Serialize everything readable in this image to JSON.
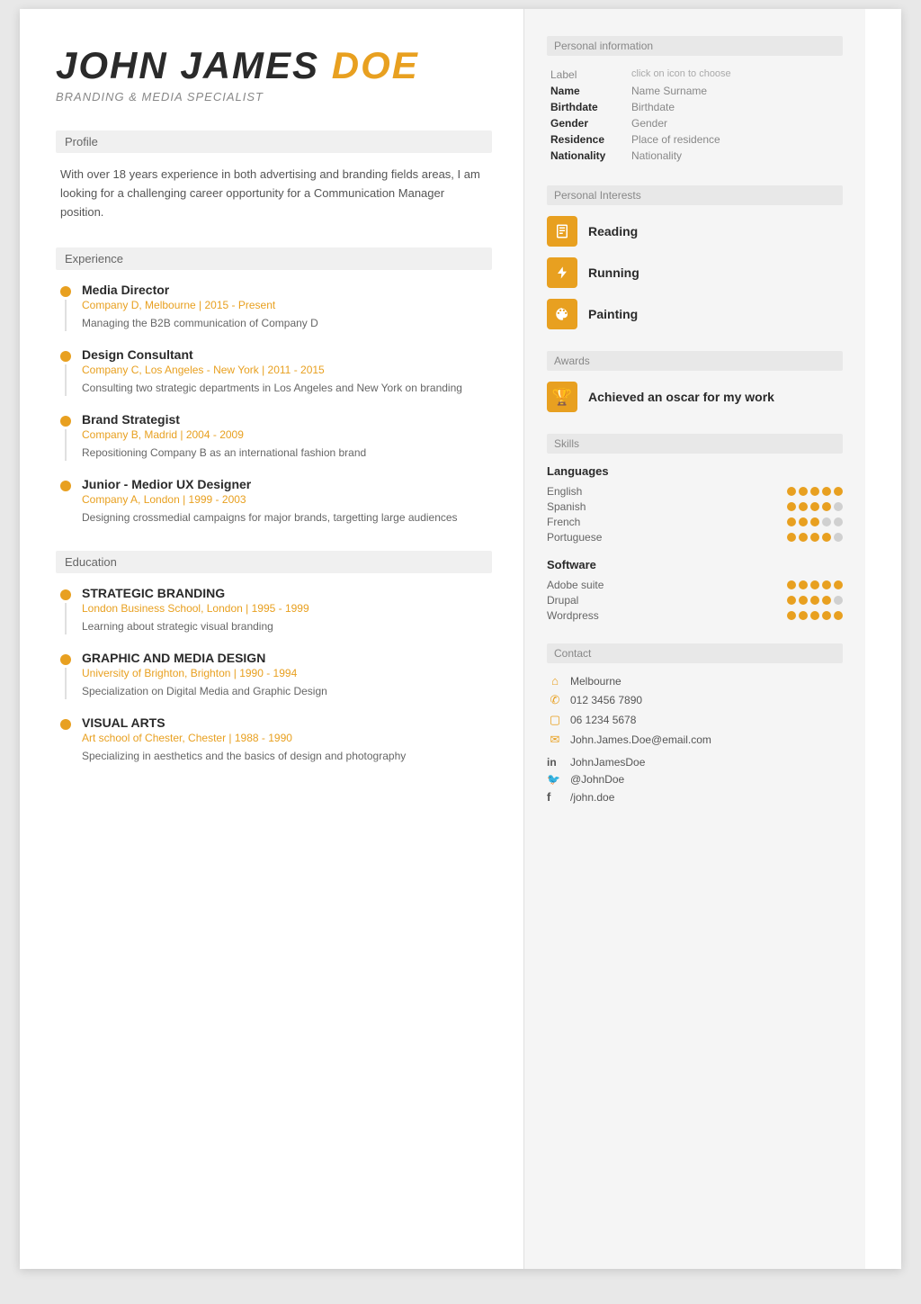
{
  "header": {
    "first_name": "JOHN JAMES",
    "last_name": "DOE",
    "job_title": "BRANDING & MEDIA SPECIALIST"
  },
  "profile": {
    "section_label": "Profile",
    "text": "With over 18 years experience in both advertising and branding fields areas, I am looking for a challenging career opportunity for a Communication Manager position."
  },
  "experience": {
    "section_label": "Experience",
    "items": [
      {
        "title": "Media Director",
        "subtitle": "Company D, Melbourne | 2015 - Present",
        "desc": "Managing the B2B communication of Company D"
      },
      {
        "title": "Design Consultant",
        "subtitle": "Company C, Los Angeles - New York | 2011 - 2015",
        "desc": "Consulting two strategic departments in Los Angeles and New York on branding"
      },
      {
        "title": "Brand Strategist",
        "subtitle": "Company B, Madrid | 2004 - 2009",
        "desc": "Repositioning Company B as an international fashion brand"
      },
      {
        "title": "Junior - Medior UX Designer",
        "subtitle": "Company A, London | 1999 - 2003",
        "desc": "Designing crossmedial campaigns for major brands, targetting large audiences"
      }
    ]
  },
  "education": {
    "section_label": "Education",
    "items": [
      {
        "title": "STRATEGIC BRANDING",
        "subtitle": "London Business School, London | 1995 - 1999",
        "desc": "Learning about strategic visual branding"
      },
      {
        "title": "GRAPHIC AND MEDIA DESIGN",
        "subtitle": "University of Brighton, Brighton | 1990 - 1994",
        "desc": "Specialization on Digital Media and Graphic Design"
      },
      {
        "title": "VISUAL ARTS",
        "subtitle": "Art school of Chester, Chester | 1988 - 1990",
        "desc": "Specializing in aesthetics and the basics of design and photography"
      }
    ]
  },
  "personal_info": {
    "section_label": "Personal information",
    "hint": "click on icon to choose",
    "fields": [
      {
        "label": "Label",
        "value": "click on icon to choose"
      },
      {
        "label": "Name",
        "value": "Name Surname"
      },
      {
        "label": "Birthdate",
        "value": "Birthdate"
      },
      {
        "label": "Gender",
        "value": "Gender"
      },
      {
        "label": "Residence",
        "value": "Place of residence"
      },
      {
        "label": "Nationality",
        "value": "Nationality"
      }
    ]
  },
  "interests": {
    "section_label": "Personal Interests",
    "items": [
      {
        "name": "Reading",
        "icon": "book"
      },
      {
        "name": "Running",
        "icon": "bolt"
      },
      {
        "name": "Painting",
        "icon": "palette"
      }
    ]
  },
  "awards": {
    "section_label": "Awards",
    "items": [
      {
        "text": "Achieved an oscar for my work"
      }
    ]
  },
  "skills": {
    "section_label": "Skills",
    "languages": {
      "subtitle": "Languages",
      "items": [
        {
          "name": "English",
          "filled": 5,
          "empty": 0
        },
        {
          "name": "Spanish",
          "filled": 4,
          "empty": 1
        },
        {
          "name": "French",
          "filled": 3,
          "empty": 2
        },
        {
          "name": "Portuguese",
          "filled": 4,
          "empty": 1
        }
      ]
    },
    "software": {
      "subtitle": "Software",
      "items": [
        {
          "name": "Adobe suite",
          "filled": 5,
          "empty": 0
        },
        {
          "name": "Drupal",
          "filled": 4,
          "empty": 1
        },
        {
          "name": "Wordpress",
          "filled": 5,
          "empty": 0
        }
      ]
    }
  },
  "contact": {
    "section_label": "Contact",
    "items": [
      {
        "icon": "home",
        "value": "Melbourne"
      },
      {
        "icon": "phone",
        "value": "012 3456 7890"
      },
      {
        "icon": "mobile",
        "value": "06 1234 5678"
      },
      {
        "icon": "email",
        "value": "John.James.Doe@email.com"
      }
    ],
    "social": [
      {
        "icon": "in",
        "value": "JohnJamesDoe"
      },
      {
        "icon": "tw",
        "value": "@JohnDoe"
      },
      {
        "icon": "fb",
        "value": "/john.doe"
      }
    ]
  }
}
